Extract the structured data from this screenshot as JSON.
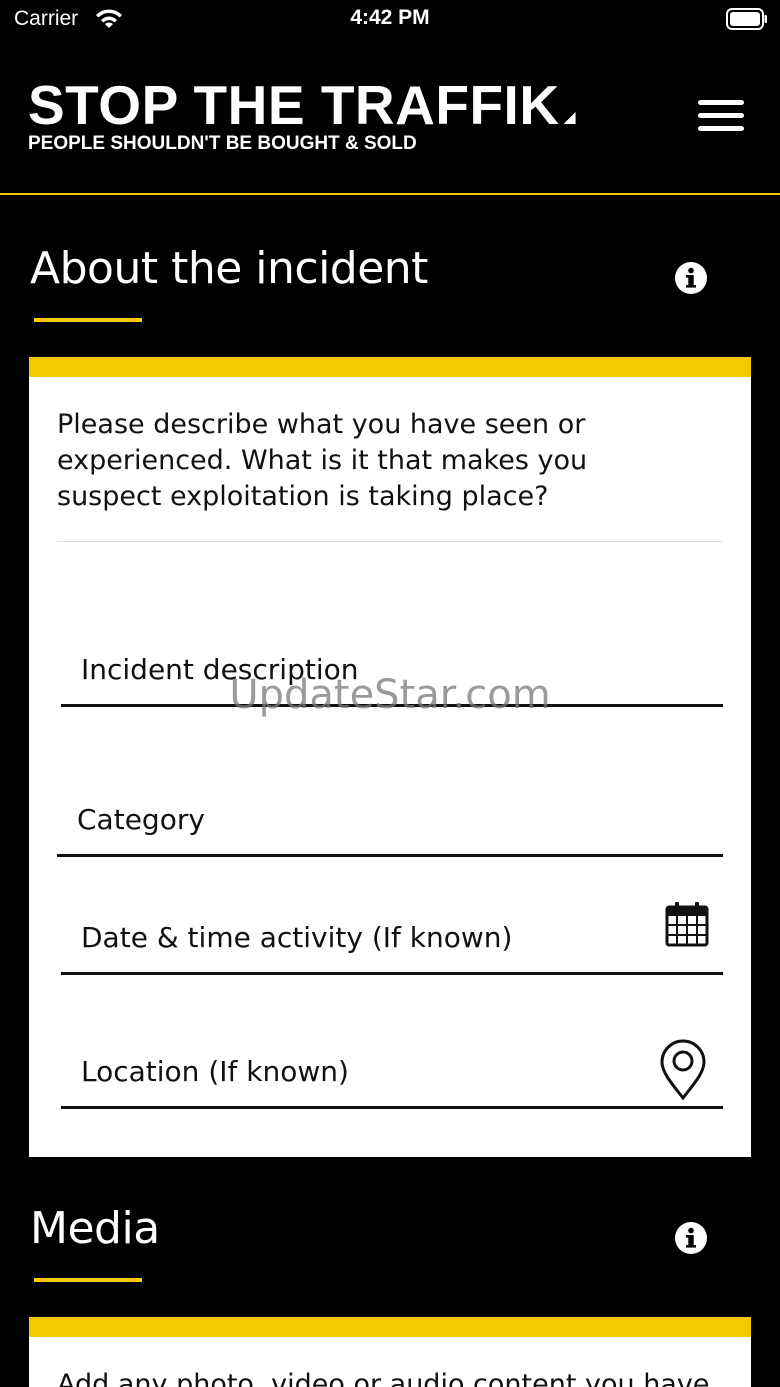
{
  "status_bar": {
    "carrier": "Carrier",
    "time": "4:42 PM"
  },
  "header": {
    "logo_title": "STOP THE TRAFFIK",
    "logo_tagline": "PEOPLE SHOULDN'T BE BOUGHT & SOLD",
    "menu_icon": "hamburger-menu-icon"
  },
  "incident_section": {
    "title": "About the incident",
    "info_icon": "info-icon",
    "prompt": "Please describe what you have seen or experienced. What is it that makes you suspect exploitation is taking place?",
    "fields": {
      "description_label": "Incident description",
      "category_label": "Category",
      "datetime_label": "Date & time activity (If known)",
      "location_label": "Location (If known)"
    }
  },
  "media_section": {
    "title": "Media",
    "info_icon": "info-icon",
    "prompt": "Add any photo, video or audio content you have"
  },
  "watermark": "UpdateStar.com",
  "colors": {
    "background": "#000000",
    "accent": "#f6c800",
    "card": "#ffffff",
    "text_dark": "#111111"
  }
}
